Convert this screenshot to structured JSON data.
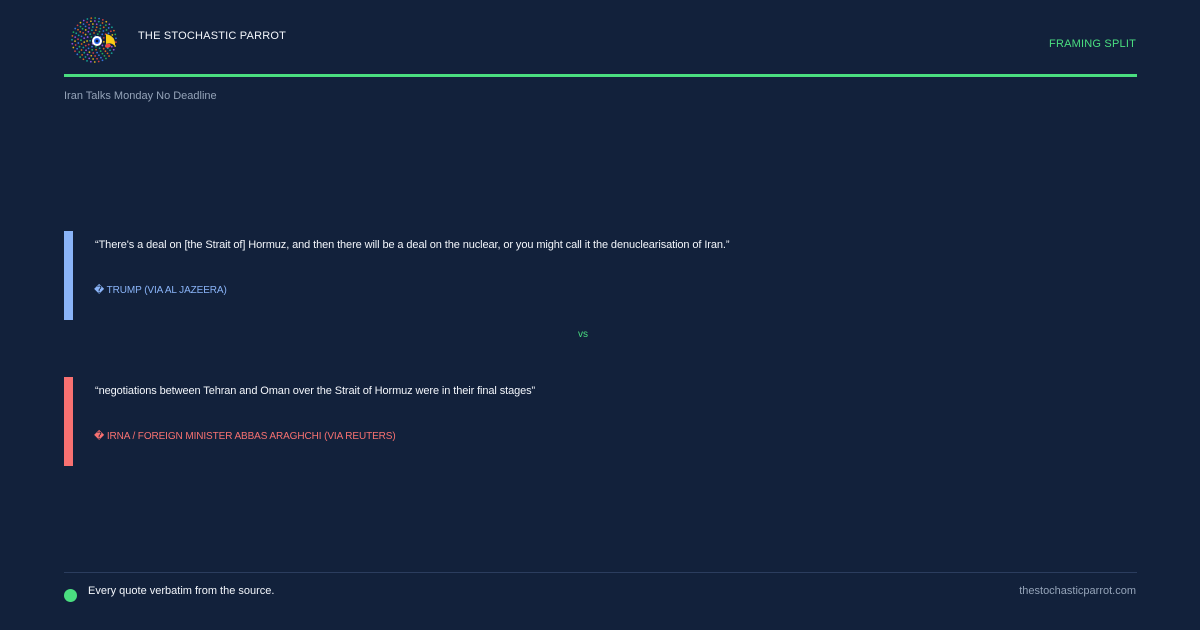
{
  "header": {
    "brand": "THE STOCHASTIC PARROT",
    "tag": "FRAMING SPLIT",
    "logo_icon": "parrot-logo-icon"
  },
  "subtitle": "Iran Talks Monday No Deadline",
  "quotes": [
    {
      "text": "“There's a deal on [the Strait of] Hormuz, and then there will be a deal on the nuclear, or you might call it the denuclearisation of Iran.”",
      "source": "� TRUMP (VIA AL JAZEERA)",
      "color": "#8ab4f8"
    },
    {
      "text": "“negotiations between Tehran and Oman over the Strait of Hormuz were in their final stages”",
      "source": "� IRNA / FOREIGN MINISTER ABBAS ARAGHCHI (VIA REUTERS)",
      "color": "#f87171"
    }
  ],
  "separator": "vs",
  "footer": {
    "note": "Every quote verbatim from the source.",
    "site": "thestochasticparrot.com"
  },
  "colors": {
    "background": "#12213b",
    "accent": "#4ade80",
    "muted": "#94a3b8"
  }
}
